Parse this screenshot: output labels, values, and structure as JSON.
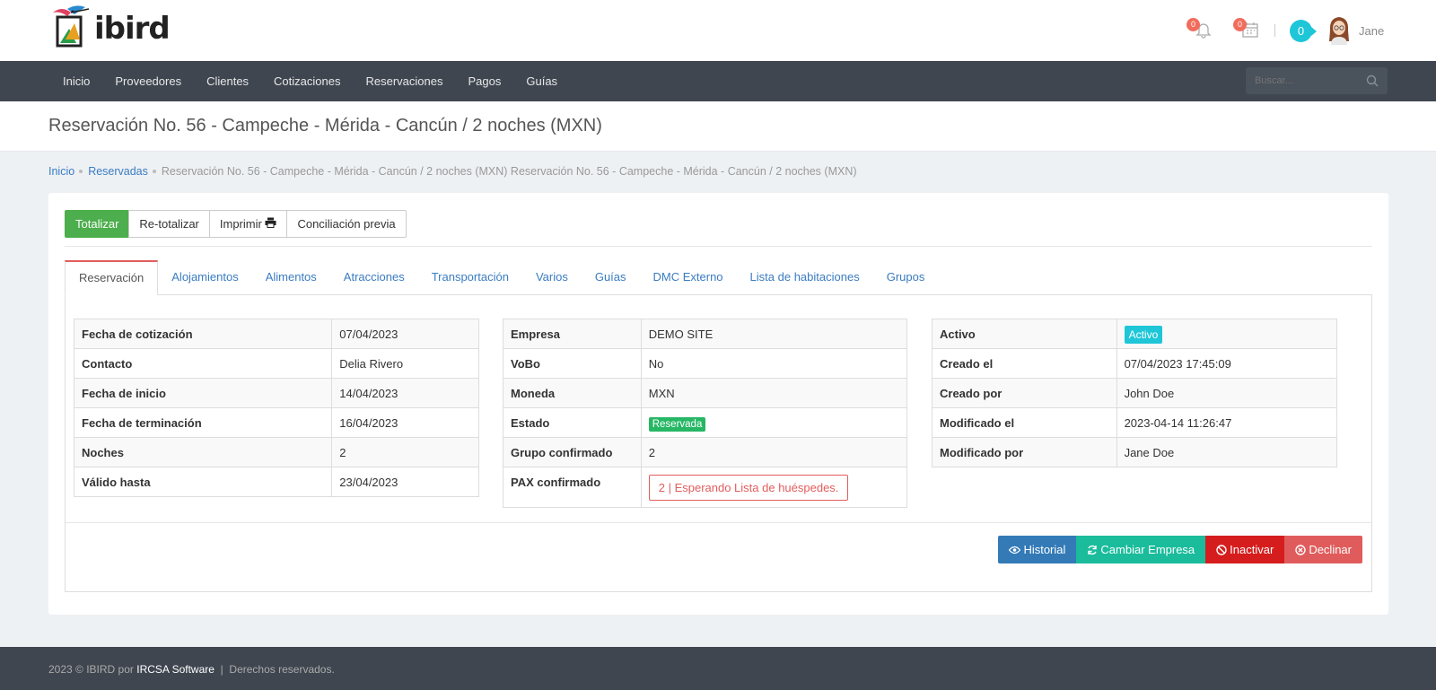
{
  "app": {
    "logo_text": "ibird"
  },
  "header": {
    "notifications_count": "0",
    "calendar_count": "0",
    "user_count": "0",
    "user_name": "Jane"
  },
  "nav": {
    "items": [
      "Inicio",
      "Proveedores",
      "Clientes",
      "Cotizaciones",
      "Reservaciones",
      "Pagos",
      "Guías"
    ],
    "search_placeholder": "Buscar..."
  },
  "page": {
    "title": "Reservación No. 56 - Campeche - Mérida - Cancún / 2 noches (MXN)"
  },
  "breadcrumb": {
    "items": [
      "Inicio",
      "Reservadas"
    ],
    "current": "Reservación No. 56 - Campeche - Mérida - Cancún / 2 noches (MXN) Reservación No. 56 - Campeche - Mérida - Cancún / 2 noches (MXN)"
  },
  "toolbar": {
    "totalizar": "Totalizar",
    "retotalizar": "Re-totalizar",
    "imprimir": "Imprimir",
    "conciliacion": "Conciliación previa"
  },
  "tabs": [
    "Reservación",
    "Alojamientos",
    "Alimentos",
    "Atracciones",
    "Transportación",
    "Varios",
    "Guías",
    "DMC Externo",
    "Lista de habitaciones",
    "Grupos"
  ],
  "reservation": {
    "left": [
      {
        "key": "Fecha de cotización",
        "value": "07/04/2023"
      },
      {
        "key": "Contacto",
        "value": "Delia Rivero"
      },
      {
        "key": "Fecha de inicio",
        "value": "14/04/2023"
      },
      {
        "key": "Fecha de terminación",
        "value": "16/04/2023"
      },
      {
        "key": "Noches",
        "value": "2"
      },
      {
        "key": "Válido hasta",
        "value": "23/04/2023"
      }
    ],
    "middle": [
      {
        "key": "Empresa",
        "value": "DEMO SITE"
      },
      {
        "key": "VoBo",
        "value": "No"
      },
      {
        "key": "Moneda",
        "value": "MXN"
      },
      {
        "key": "Estado",
        "value": "Reservada"
      },
      {
        "key": "Grupo confirmado",
        "value": "2"
      },
      {
        "key": "PAX confirmado",
        "value": "2 | Esperando Lista de huéspedes."
      }
    ],
    "right": [
      {
        "key": "Activo",
        "value": "Activo"
      },
      {
        "key": "Creado el",
        "value": "07/04/2023 17:45:09"
      },
      {
        "key": "Creado por",
        "value": "John Doe"
      },
      {
        "key": "Modificado el",
        "value": "2023-04-14 11:26:47"
      },
      {
        "key": "Modificado por",
        "value": "Jane Doe"
      }
    ]
  },
  "actions": {
    "historial": "Historial",
    "cambiar_empresa": "Cambiar Empresa",
    "inactivar": "Inactivar",
    "declinar": "Declinar"
  },
  "footer": {
    "prefix": "2023 © IBIRD por",
    "company": "IRCSA Software",
    "sep": "|",
    "rights": "Derechos reservados."
  },
  "colors": {
    "nav_bg": "#3f4650",
    "success": "#4cae4c",
    "info": "#1ec6d8",
    "danger": "#d51d1d",
    "primary": "#337ab7",
    "teal": "#1abc9c"
  }
}
